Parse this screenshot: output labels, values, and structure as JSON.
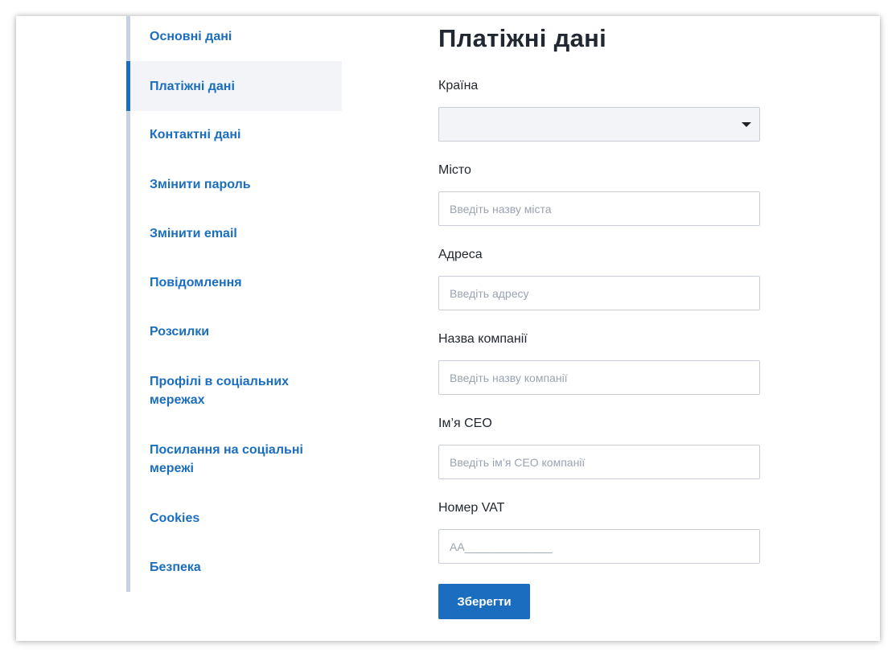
{
  "sidebar": {
    "items": [
      {
        "label": "Основні дані"
      },
      {
        "label": "Платіжні дані",
        "active": true
      },
      {
        "label": "Контактні дані"
      },
      {
        "label": "Змінити пароль"
      },
      {
        "label": "Змінити email"
      },
      {
        "label": "Повідомлення"
      },
      {
        "label": "Розсилки"
      },
      {
        "label": "Профілі в соціальних мережах"
      },
      {
        "label": "Посилання на соціальні мережі"
      },
      {
        "label": "Cookies"
      },
      {
        "label": "Безпека"
      }
    ]
  },
  "main": {
    "title": "Платіжні дані",
    "country": {
      "label": "Країна",
      "value": "",
      "icon": "chevron-down-icon"
    },
    "city": {
      "label": "Місто",
      "placeholder": "Введіть назву міста",
      "value": ""
    },
    "address": {
      "label": "Адреса",
      "placeholder": "Введіть адресу",
      "value": ""
    },
    "company": {
      "label": "Назва компанії",
      "placeholder": "Введіть назву компанії",
      "value": ""
    },
    "ceo": {
      "label": "Ім’я CEO",
      "placeholder": "Введіть ім’я CEO компанії",
      "value": ""
    },
    "vat": {
      "label": "Номер VAT",
      "placeholder": "AA______________",
      "value": ""
    },
    "save_label": "Зберегти"
  },
  "colors": {
    "accent": "#1b6ebf",
    "sidebar_border": "#c6d2e3",
    "active_bg": "#f2f4f8",
    "text": "#222831"
  }
}
